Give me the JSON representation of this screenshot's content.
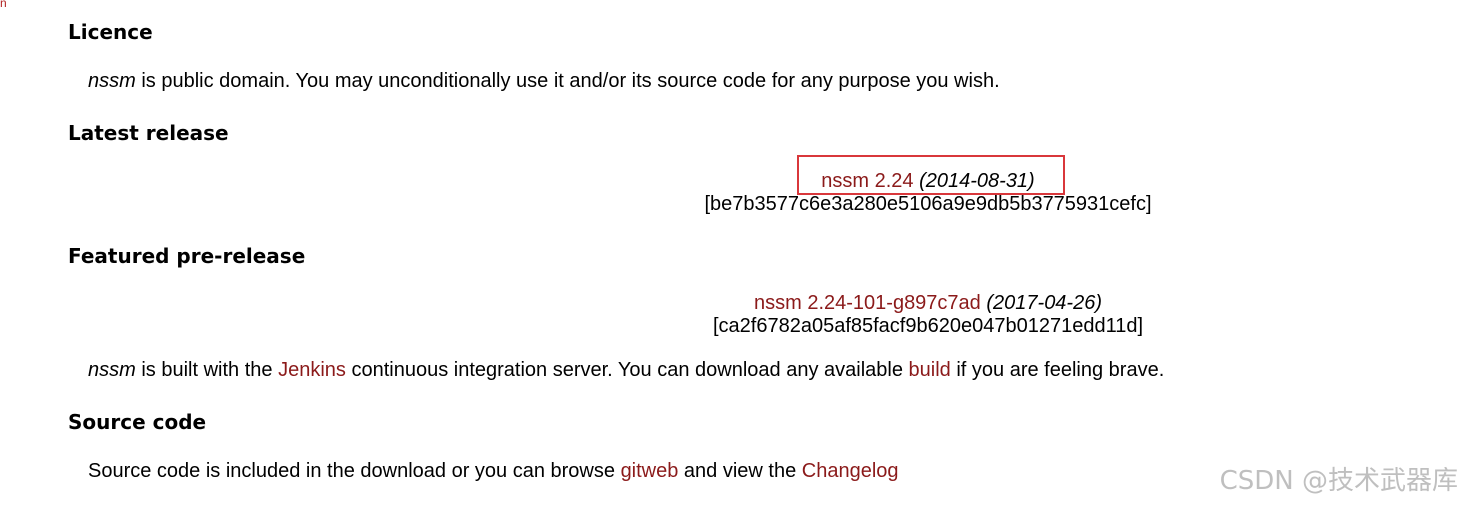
{
  "licence": {
    "heading": "Licence",
    "nssm": "nssm",
    "text": " is public domain. You may unconditionally use it and/or its source code for any purpose you wish."
  },
  "latest": {
    "heading": "Latest release",
    "link": "nssm 2.24",
    "date": "(2014-08-31)",
    "hash": "[be7b3577c6e3a280e5106a9e9db5b3775931cefc]"
  },
  "prerelease": {
    "heading": "Featured pre-release",
    "link": "nssm 2.24-101-g897c7ad",
    "date": "(2017-04-26)",
    "hash": "[ca2f6782a05af85facf9b620e047b01271edd11d]",
    "nssm": "nssm",
    "text1": " is built with the ",
    "jenkins": "Jenkins",
    "text2": " continuous integration server. You can download any available ",
    "build": "build",
    "text3": " if you are feeling brave."
  },
  "source": {
    "heading": "Source code",
    "text1": "Source code is included in the download or you can browse ",
    "gitweb": "gitweb",
    "text2": " and view the ",
    "changelog": "Changelog"
  },
  "watermark": "CSDN @技术武器库",
  "colors": {
    "link": "#8b1a1a",
    "highlight": "#d9373b"
  }
}
